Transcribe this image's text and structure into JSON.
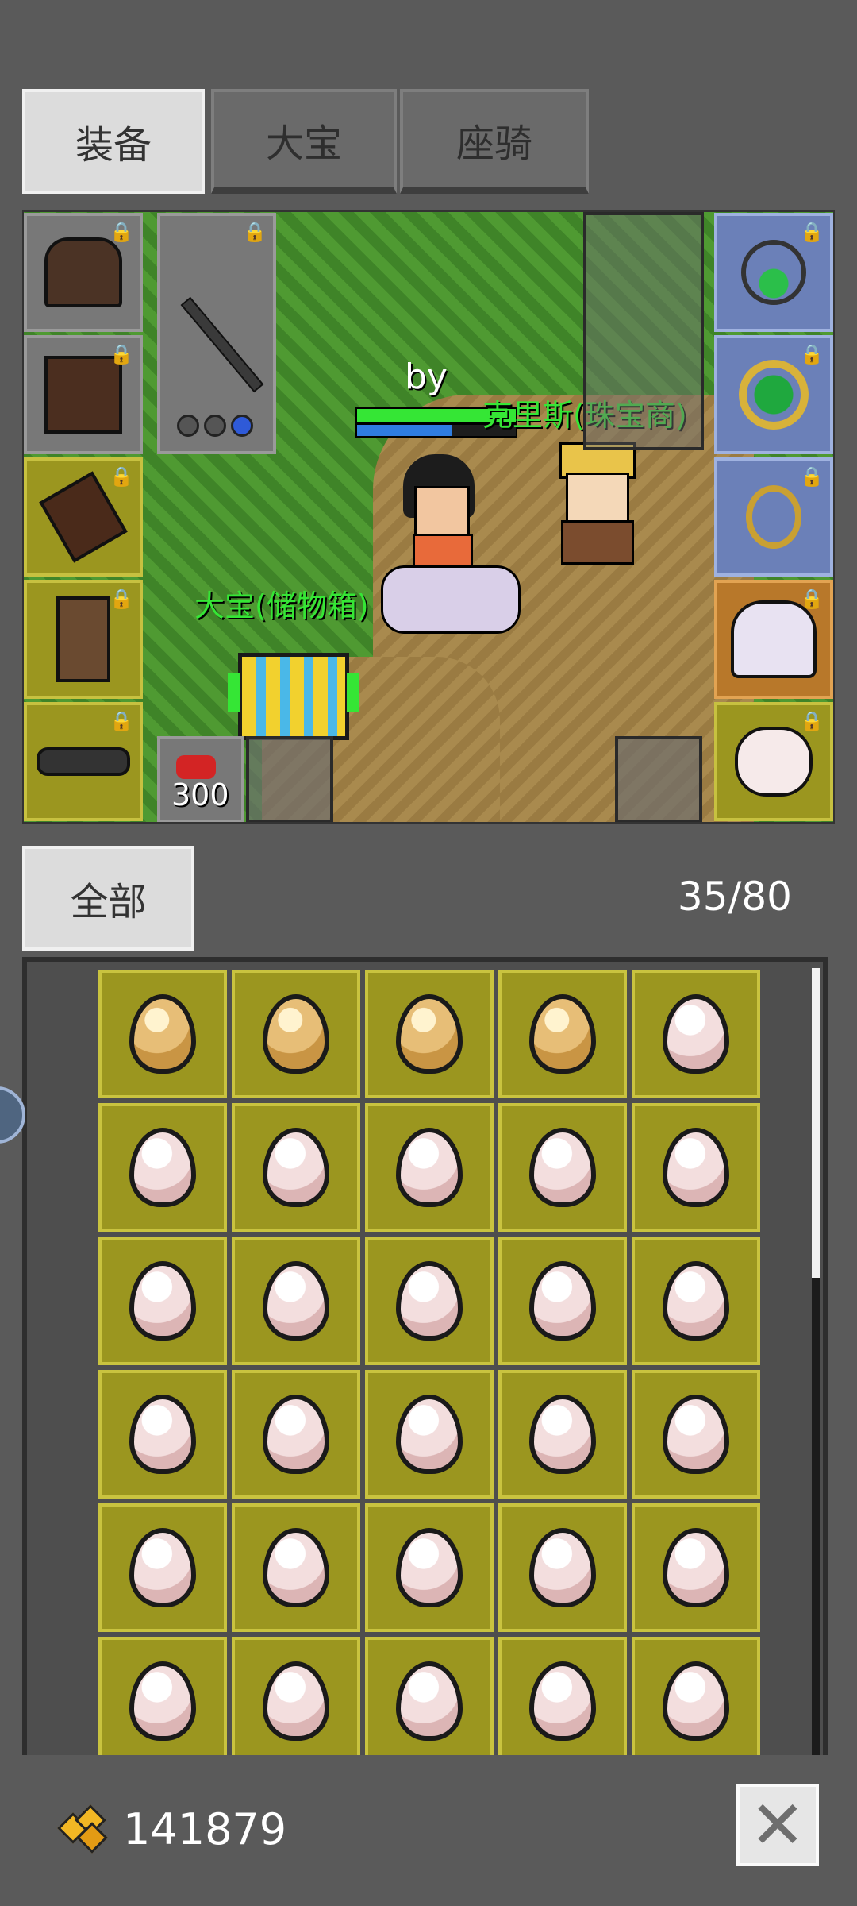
{
  "tabs": [
    {
      "label": "装备",
      "active": true
    },
    {
      "label": "大宝",
      "active": false
    },
    {
      "label": "座骑",
      "active": false
    }
  ],
  "scene": {
    "player_name": "by",
    "npc_label": "克里斯(珠宝商)",
    "storage_label": "大宝(储物箱)",
    "potion_count": "300"
  },
  "filter": {
    "label": "全部",
    "capacity": "35/80"
  },
  "inventory": {
    "rows": [
      [
        "gold",
        "gold",
        "gold",
        "gold",
        "pink"
      ],
      [
        "pink",
        "pink",
        "pink",
        "pink",
        "pink"
      ],
      [
        "pink",
        "pink",
        "pink",
        "pink",
        "pink"
      ],
      [
        "pink",
        "pink",
        "pink",
        "pink",
        "pink"
      ],
      [
        "pink",
        "pink",
        "pink",
        "pink",
        "pink"
      ],
      [
        "pink",
        "pink",
        "pink",
        "pink",
        "pink"
      ]
    ]
  },
  "gold": {
    "amount": "141879",
    "icon": "gold-coins-icon"
  },
  "colors": {
    "cell": "#9b961f",
    "accent_green": "#35e635"
  }
}
